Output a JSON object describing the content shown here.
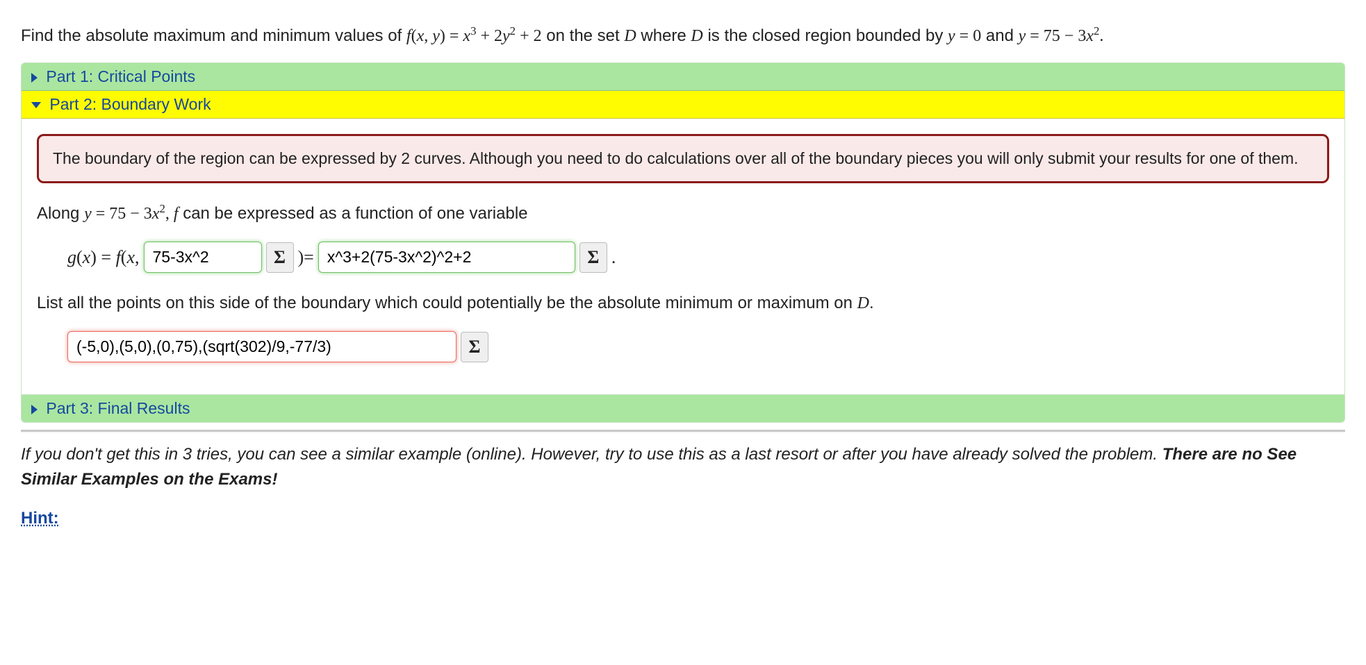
{
  "problem": {
    "prefix": "Find the absolute maximum and minimum values of ",
    "func_lhs_f": "f",
    "func_lhs_open": "(",
    "func_lhs_x": "x",
    "func_lhs_comma": ", ",
    "func_lhs_y": "y",
    "func_lhs_close": ") = ",
    "func_rhs_x": "x",
    "func_rhs_exp1": "3",
    "func_rhs_plus1": " + 2",
    "func_rhs_y": "y",
    "func_rhs_exp2": "2",
    "func_rhs_plus2": " + 2",
    "after_func": " on the set ",
    "set_D1": "D",
    "where": " where ",
    "set_D2": "D",
    "closed_region": " is the closed region bounded by ",
    "curve1_y": "y",
    "curve1_eq": " = 0",
    "and": " and ",
    "curve2_y": "y",
    "curve2_eq_a": " = 75 − 3",
    "curve2_x": "x",
    "curve2_exp": "2",
    "period": "."
  },
  "parts": {
    "p1": "Part 1: Critical Points",
    "p2": "Part 2: Boundary Work",
    "p3": "Part 3: Final Results"
  },
  "notice": "The boundary of the region can be expressed by 2 curves. Although you need to do calculations over all of the boundary pieces you will only submit your results for one of them.",
  "along_line": {
    "prefix": "Along ",
    "y": "y",
    "eq_a": " = 75 − 3",
    "x": "x",
    "exp": "2",
    "sep": ", ",
    "f": "f",
    "suffix": " can be expressed as a function of one variable"
  },
  "gx": {
    "g": "g",
    "open1": "(",
    "x1": "x",
    "close1": ")",
    "eq": " = ",
    "f": "f",
    "open2": "(",
    "x2": "x",
    "comma": ",   ",
    "input1_value": "75-3x^2",
    "sigma": "Σ",
    "close_eq": ")= ",
    "input2_value": "x^3+2(75-3x^2)^2+2",
    "trail": "  ."
  },
  "list_line": {
    "prefix": "List all the points on this side of the boundary which could potentially be the absolute minimum or maximum on ",
    "D": "D",
    "period": "."
  },
  "points_input": {
    "value": "(-5,0),(5,0),(0,75),(sqrt(302)/9,-77/3)",
    "sigma": "Σ"
  },
  "footnote": {
    "text": "If you don't get this in 3 tries, you can see a similar example (online). However, try to use this as a last resort or after you have already solved the problem. ",
    "bold": "There are no See Similar Examples on the Exams!"
  },
  "hint": "Hint:"
}
